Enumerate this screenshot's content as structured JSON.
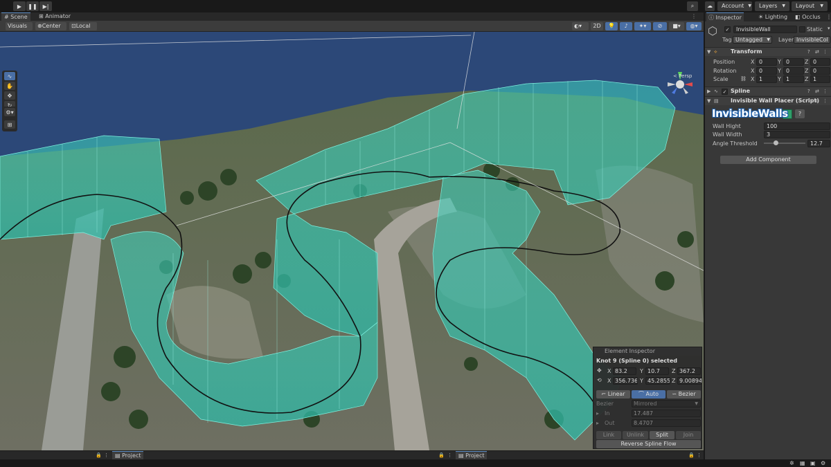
{
  "toolbar": {
    "account_label": "Account",
    "layers_label": "Layers",
    "layout_label": "Layout",
    "play_icon": "play-icon",
    "pause_icon": "pause-icon",
    "step_icon": "step-icon"
  },
  "scene_tabs": [
    {
      "label": "Scene",
      "active": true
    },
    {
      "label": "Animator",
      "active": false
    }
  ],
  "scene_toolbar": {
    "visuals_label": "Visuals",
    "pivot_label": "Center",
    "space_label": "Local",
    "mode_2d_label": "2D"
  },
  "viewport": {
    "perspective_label": "< Persp"
  },
  "element_inspector": {
    "title": "Element Inspector",
    "selection_label": "Knot 9 (Spline 0) selected",
    "position": {
      "x_label": "X",
      "x": "83.2",
      "y_label": "Y",
      "y": "10.7",
      "z_label": "Z",
      "z": "367.2"
    },
    "world": {
      "x_label": "X",
      "x": "356.7364",
      "y_label": "Y",
      "y": "45.28559",
      "z_label": "Z",
      "z": "9.008943"
    },
    "tangent_modes": [
      {
        "label": "Linear",
        "active": false
      },
      {
        "label": "Auto",
        "active": true
      },
      {
        "label": "Bezier",
        "active": false
      }
    ],
    "bezier_label": "Bezier",
    "bezier_value": "Mirrored",
    "in_label": "In",
    "in_value": "17.487",
    "out_label": "Out",
    "out_value": "8.4707",
    "actions": [
      "Link",
      "Unlink",
      "Split",
      "Join"
    ],
    "reverse_label": "Reverse Spline Flow"
  },
  "bottom_tabs": [
    {
      "label": "Project"
    },
    {
      "label": "Project"
    }
  ],
  "inspector": {
    "tabs": [
      {
        "label": "Inspector",
        "active": true
      },
      {
        "label": "Lighting",
        "active": false
      },
      {
        "label": "Occlus",
        "active": false
      }
    ],
    "object_name": "InvisibleWall",
    "static_label": "Static",
    "tag_label": "Tag",
    "tag_value": "Untagged",
    "layer_label": "Layer",
    "layer_value": "InvisibleCol",
    "transform": {
      "title": "Transform",
      "position_label": "Position",
      "rotation_label": "Rotation",
      "scale_label": "Scale",
      "axis_x": "X",
      "axis_y": "Y",
      "axis_z": "Z",
      "position": [
        "0",
        "0",
        "0"
      ],
      "rotation": [
        "0",
        "0",
        "0"
      ],
      "scale": [
        "1",
        "1",
        "1"
      ]
    },
    "spline_title": "Spline",
    "script_title": "Invisible Wall Placer (Script)",
    "logo_text": "InvisibleWalls",
    "wall_hight_label": "Wall Hight",
    "wall_hight_value": "100",
    "wall_width_label": "Wall Width",
    "wall_width_value": "3",
    "angle_label": "Angle Threshold",
    "angle_value": "12.7",
    "angle_fraction": 0.28,
    "add_component_label": "Add Component"
  },
  "colors": {
    "accent": "#4a6fa5",
    "wall": "#36c9b4",
    "water": "#2b4a82",
    "terrain": "#6d7560"
  }
}
